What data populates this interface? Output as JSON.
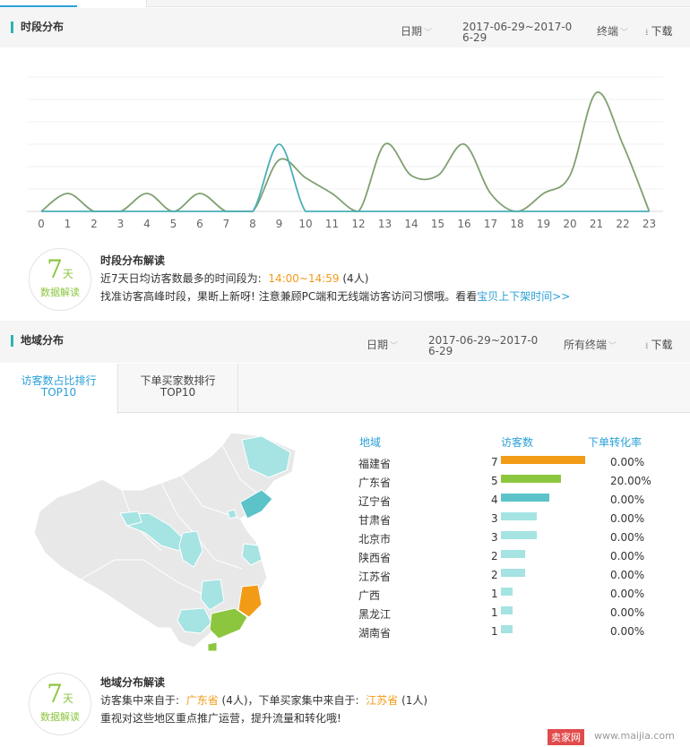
{
  "time_section": {
    "title": "时段分布",
    "date_label": "日期",
    "range": "2017-06-29~2017-06-29",
    "terminal": "终端",
    "download": "下载"
  },
  "time_chart": {
    "chart_data": {
      "type": "line",
      "x": [
        0,
        1,
        2,
        3,
        4,
        5,
        6,
        7,
        8,
        9,
        10,
        11,
        12,
        13,
        14,
        15,
        16,
        17,
        18,
        19,
        20,
        21,
        22,
        23
      ],
      "series": [
        {
          "color": "#7fa070",
          "values": [
            0,
            0.8,
            0,
            0,
            0.8,
            0,
            0.8,
            0,
            0,
            2.3,
            1.5,
            0.8,
            0,
            3,
            1.6,
            1.6,
            3,
            0.8,
            0,
            0.8,
            1.6,
            5.3,
            3,
            0
          ]
        },
        {
          "color": "#4aaeb8",
          "values": [
            0,
            0,
            0,
            0,
            0,
            0,
            0,
            0,
            0,
            3,
            0,
            0,
            0,
            0,
            0,
            0,
            0,
            0,
            0,
            0,
            0,
            0,
            0,
            0
          ]
        }
      ],
      "ylim": [
        0,
        6
      ],
      "grid": true
    }
  },
  "time_interp": {
    "title": "时段分布解读",
    "line1_prefix": "近7天日均访客数最多的时间段为:",
    "line1_range": "14:00~14:59",
    "line1_suffix": "(4人)",
    "line2_text": "找准访客高峰时段，果断上新呀! 注意兼顾PC端和无线端访客访问习惯哦。看看",
    "line2_link": "宝贝上下架时间>>"
  },
  "badge": {
    "num": "7",
    "unit": "天",
    "sub": "数据解读"
  },
  "region_section": {
    "title": "地域分布",
    "date_label": "日期",
    "range": "2017-06-29~2017-06-29",
    "terminal": "所有终端",
    "download": "下载"
  },
  "subtabs": {
    "active": {
      "line1": "访客数占比排行",
      "line2": "TOP10"
    },
    "inactive": {
      "line1": "下单买家数排行",
      "line2": "TOP10"
    }
  },
  "ranking": {
    "headers": {
      "region": "地域",
      "visitors": "访客数",
      "conversion": "下单转化率"
    },
    "rows": [
      {
        "province": "福建省",
        "visitors": 7,
        "rate": "0.00%",
        "color": "#f29b17"
      },
      {
        "province": "广东省",
        "visitors": 5,
        "rate": "20.00%",
        "color": "#8cc63f"
      },
      {
        "province": "辽宁省",
        "visitors": 4,
        "rate": "0.00%",
        "color": "#5cc3c9"
      },
      {
        "province": "甘肃省",
        "visitors": 3,
        "rate": "0.00%",
        "color": "#a6e3e3"
      },
      {
        "province": "北京市",
        "visitors": 3,
        "rate": "0.00%",
        "color": "#a6e3e3"
      },
      {
        "province": "陕西省",
        "visitors": 2,
        "rate": "0.00%",
        "color": "#a6e3e3"
      },
      {
        "province": "江苏省",
        "visitors": 2,
        "rate": "0.00%",
        "color": "#a6e3e3"
      },
      {
        "province": "广西",
        "visitors": 1,
        "rate": "0.00%",
        "color": "#a6e3e3"
      },
      {
        "province": "黑龙江",
        "visitors": 1,
        "rate": "0.00%",
        "color": "#a6e3e3"
      },
      {
        "province": "湖南省",
        "visitors": 1,
        "rate": "0.00%",
        "color": "#a6e3e3"
      }
    ],
    "max": 7
  },
  "region_interp": {
    "title": "地域分布解读",
    "line1_a": "访客集中来自于:",
    "line1_prov1": "广东省",
    "line1_b": "(4人)，下单买家集中来自于:",
    "line1_prov2": "江苏省",
    "line1_c": "(1人)",
    "line2": "重视对这些地区重点推广运营，提升流量和转化哦!"
  },
  "watermark": {
    "brand": "卖家网",
    "url": "www.maijia.com"
  }
}
